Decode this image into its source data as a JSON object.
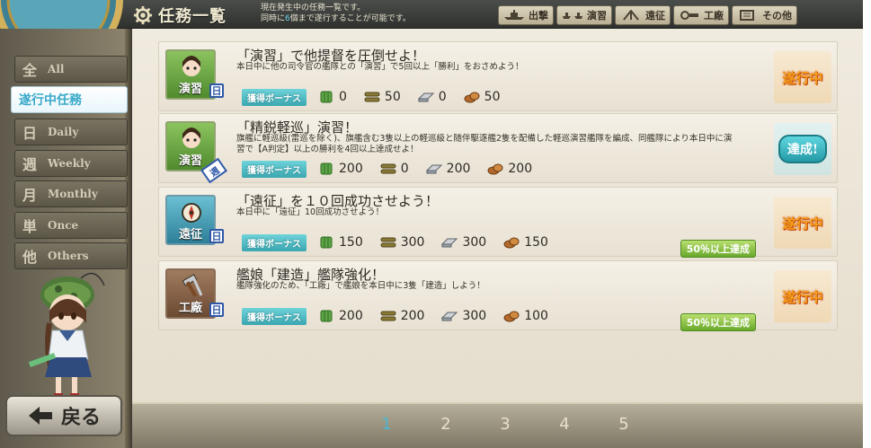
{
  "header": {
    "title": "任務一覧",
    "info_line1": "現在発生中の任務一覧です。",
    "info_line2_pre": "同時に",
    "info_line2_num": "6",
    "info_line2_post": "個まで遂行することが可能です。",
    "nav": [
      {
        "label": "出撃",
        "icon": "ship-icon"
      },
      {
        "label": "演習",
        "icon": "drill-ships-icon"
      },
      {
        "label": "遠征",
        "icon": "expedition-icon"
      },
      {
        "label": "工廠",
        "icon": "arsenal-icon"
      },
      {
        "label": "その他",
        "icon": "book-icon"
      }
    ]
  },
  "filters": [
    {
      "big": "全",
      "small": "All"
    },
    {
      "big": "",
      "small": "遂行中任務"
    },
    {
      "big": "日",
      "small": "Daily"
    },
    {
      "big": "週",
      "small": "Weekly"
    },
    {
      "big": "月",
      "small": "Monthly"
    },
    {
      "big": "単",
      "small": "Once"
    },
    {
      "big": "他",
      "small": "Others"
    }
  ],
  "active_filter": "遂行中任務",
  "back_label": "戻る",
  "bonus_label": "獲得ボーナス",
  "quests": [
    {
      "category": "演習",
      "period_badge": "日",
      "title": "「演習」で他提督を圧倒せよ！",
      "desc": "本日中に他の司令官の艦隊との「演習」で5回以上「勝利」をおさめよう！",
      "rewards": {
        "fuel": "0",
        "ammo": "50",
        "steel": "0",
        "bauxite": "50"
      },
      "status": "遂行中",
      "progress": ""
    },
    {
      "category": "演習",
      "period_badge": "週",
      "title": "「精鋭軽巡」演習！",
      "desc": "旗艦に軽巡級(雷巡を除く)、旗艦含む3隻以上の軽巡級と随伴駆逐艦2隻を配備した軽巡演習艦隊を編成、同艦隊により本日中に演習で【A判定】以上の勝利を4回以上達成せよ！",
      "rewards": {
        "fuel": "200",
        "ammo": "0",
        "steel": "200",
        "bauxite": "200"
      },
      "status": "達成!",
      "progress": ""
    },
    {
      "category": "遠征",
      "period_badge": "日",
      "title": "「遠征」を１０回成功させよう！",
      "desc": "本日中に「遠征」10回成功させよう！",
      "rewards": {
        "fuel": "150",
        "ammo": "300",
        "steel": "300",
        "bauxite": "150"
      },
      "status": "遂行中",
      "progress": "50％以上達成"
    },
    {
      "category": "工廠",
      "period_badge": "日",
      "title": "艦娘「建造」艦隊強化！",
      "desc": "艦隊強化のため、「工廠」で艦娘を本日中に3隻「建造」しよう！",
      "rewards": {
        "fuel": "200",
        "ammo": "200",
        "steel": "300",
        "bauxite": "100"
      },
      "status": "遂行中",
      "progress": "50％以上達成"
    }
  ],
  "pages": [
    "1",
    "2",
    "3",
    "4",
    "5"
  ],
  "current_page": "1",
  "colors": {
    "accent_blue": "#4db6d3",
    "in_progress_orange": "#f4a01c",
    "bonus_tag": "#3aa7b1"
  }
}
